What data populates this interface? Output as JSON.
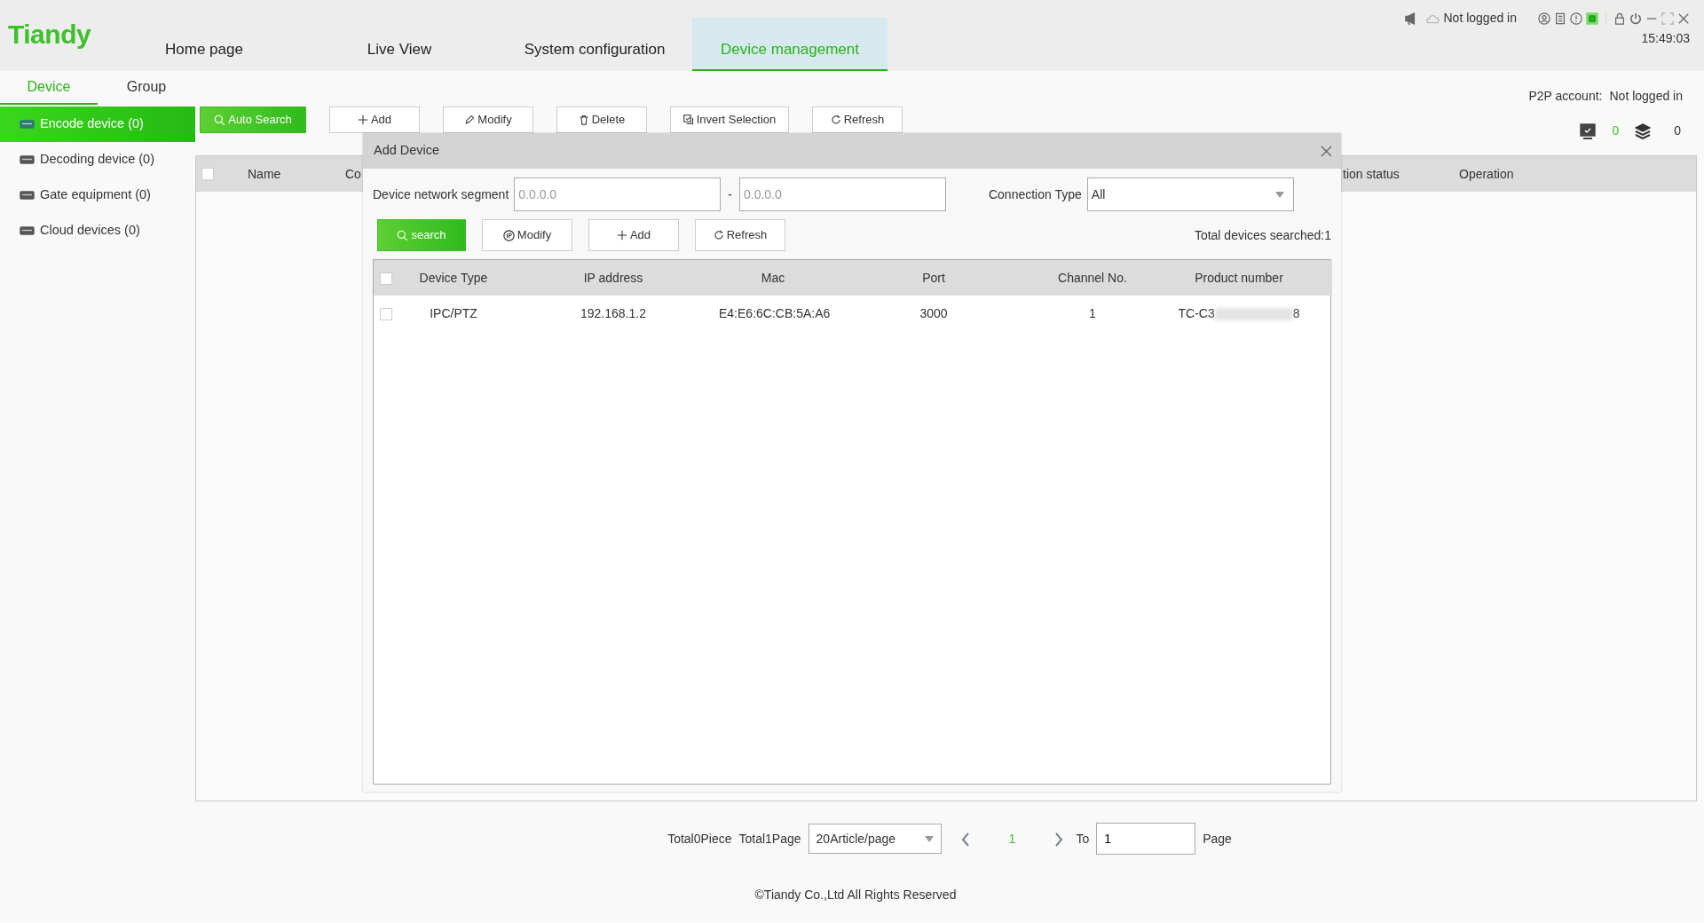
{
  "header": {
    "logo": "Tiandy",
    "nav": [
      {
        "label": "Home page",
        "selected": false
      },
      {
        "label": "Live View",
        "selected": false
      },
      {
        "label": "System configuration",
        "selected": false
      },
      {
        "label": "Device management",
        "selected": true
      }
    ],
    "login_status": "Not logged in",
    "time": "15:49:03"
  },
  "subtabs": [
    {
      "label": "Device",
      "selected": true
    },
    {
      "label": "Group",
      "selected": false
    }
  ],
  "sidebar": {
    "items": [
      {
        "label": "Encode device (0)",
        "selected": true
      },
      {
        "label": "Decoding device (0)",
        "selected": false
      },
      {
        "label": "Gate equipment (0)",
        "selected": false
      },
      {
        "label": "Cloud devices (0)",
        "selected": false
      }
    ]
  },
  "toolbar": {
    "buttons": [
      {
        "label": "Auto Search",
        "kind": "search",
        "primary": true
      },
      {
        "label": "Add",
        "kind": "add",
        "primary": false
      },
      {
        "label": "Modify",
        "kind": "modify",
        "primary": false
      },
      {
        "label": "Delete",
        "kind": "delete",
        "primary": false
      },
      {
        "label": "Invert Selection",
        "kind": "invert",
        "primary": false
      },
      {
        "label": "Refresh",
        "kind": "refresh",
        "primary": false
      }
    ]
  },
  "p2p": {
    "label": "P2P account:",
    "value": "Not logged in"
  },
  "counters": [
    {
      "kind": "online",
      "value": "0"
    },
    {
      "kind": "total",
      "value": "0"
    }
  ],
  "device_table": {
    "checked": false,
    "columns": [
      "Name",
      "Co",
      "tion status",
      "Operation"
    ]
  },
  "pagination": {
    "total_items": "Total0Piece",
    "total_pages": "Total1Page",
    "page_size": "20Article/page",
    "current_page": "1",
    "goto_label": "To",
    "goto_value": "1",
    "page_label": "Page"
  },
  "footer": "©Tiandy Co.,Ltd All Rights Reserved",
  "dialog": {
    "title": "Add Device",
    "segment_label": "Device network segment",
    "segment_from": {
      "placeholder": "0.0.0.0"
    },
    "separator": "-",
    "segment_to": {
      "placeholder": "0.0.0.0"
    },
    "connection_label": "Connection Type",
    "connection_value": "All",
    "buttons": [
      {
        "label": "search",
        "kind": "search",
        "primary": true
      },
      {
        "label": "Modify",
        "kind": "ip",
        "primary": false
      },
      {
        "label": "Add",
        "kind": "add",
        "primary": false
      },
      {
        "label": "Refresh",
        "kind": "refresh",
        "primary": false
      }
    ],
    "total": "Total devices searched:1",
    "table": {
      "checked": false,
      "columns": [
        "Device Type",
        "IP address",
        "Mac",
        "Port",
        "Channel No.",
        "Product number"
      ],
      "rows": [
        {
          "checked": false,
          "cells": [
            "IPC/PTZ",
            "192.168.1.2",
            "E4:E6:6C:CB:5A:A6",
            "3000",
            "1"
          ],
          "product_start": "TC-C3",
          "product_end": "8"
        }
      ]
    }
  }
}
